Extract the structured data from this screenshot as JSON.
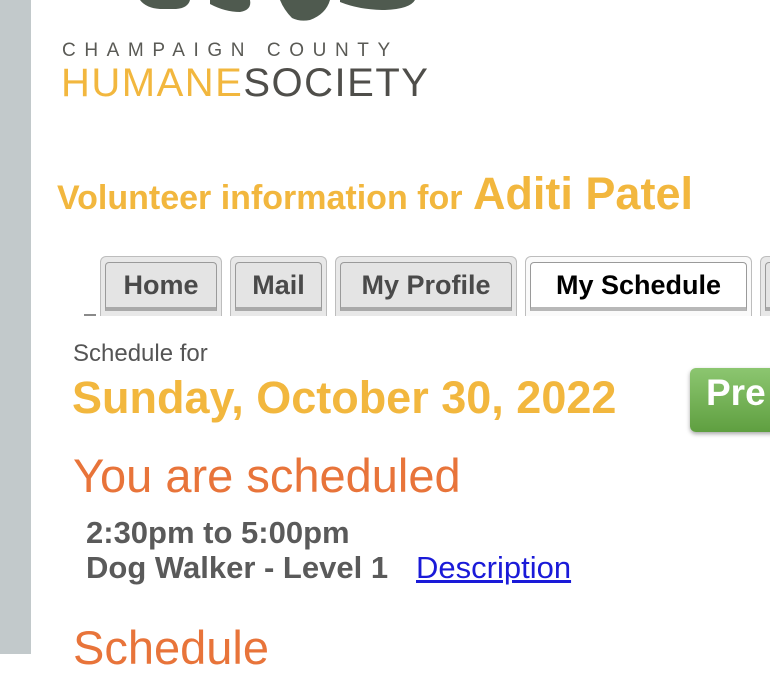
{
  "logo": {
    "county": "CHAMPAIGN COUNTY",
    "humane": "HUMANE",
    "society": "SOCIETY"
  },
  "heading": {
    "lead": "Volunteer information for",
    "name": "Aditi Patel"
  },
  "tabs": [
    {
      "label": "Home",
      "active": false
    },
    {
      "label": "Mail",
      "active": false
    },
    {
      "label": "My Profile",
      "active": false
    },
    {
      "label": "My Schedule",
      "active": true
    }
  ],
  "schedule": {
    "for_label": "Schedule for",
    "date": "Sunday, October 30, 2022",
    "prev_label": "Pre",
    "scheduled_heading": "You are scheduled",
    "shift_time": "2:30pm to 5:00pm",
    "shift_role": "Dog Walker - Level 1",
    "description_link": "Description",
    "schedule_heading": "Schedule"
  },
  "colors": {
    "brand_gold": "#f2b73e",
    "brand_orange": "#e8743a",
    "link_blue": "#1a1ad8",
    "button_green": "#6aaa4a"
  }
}
